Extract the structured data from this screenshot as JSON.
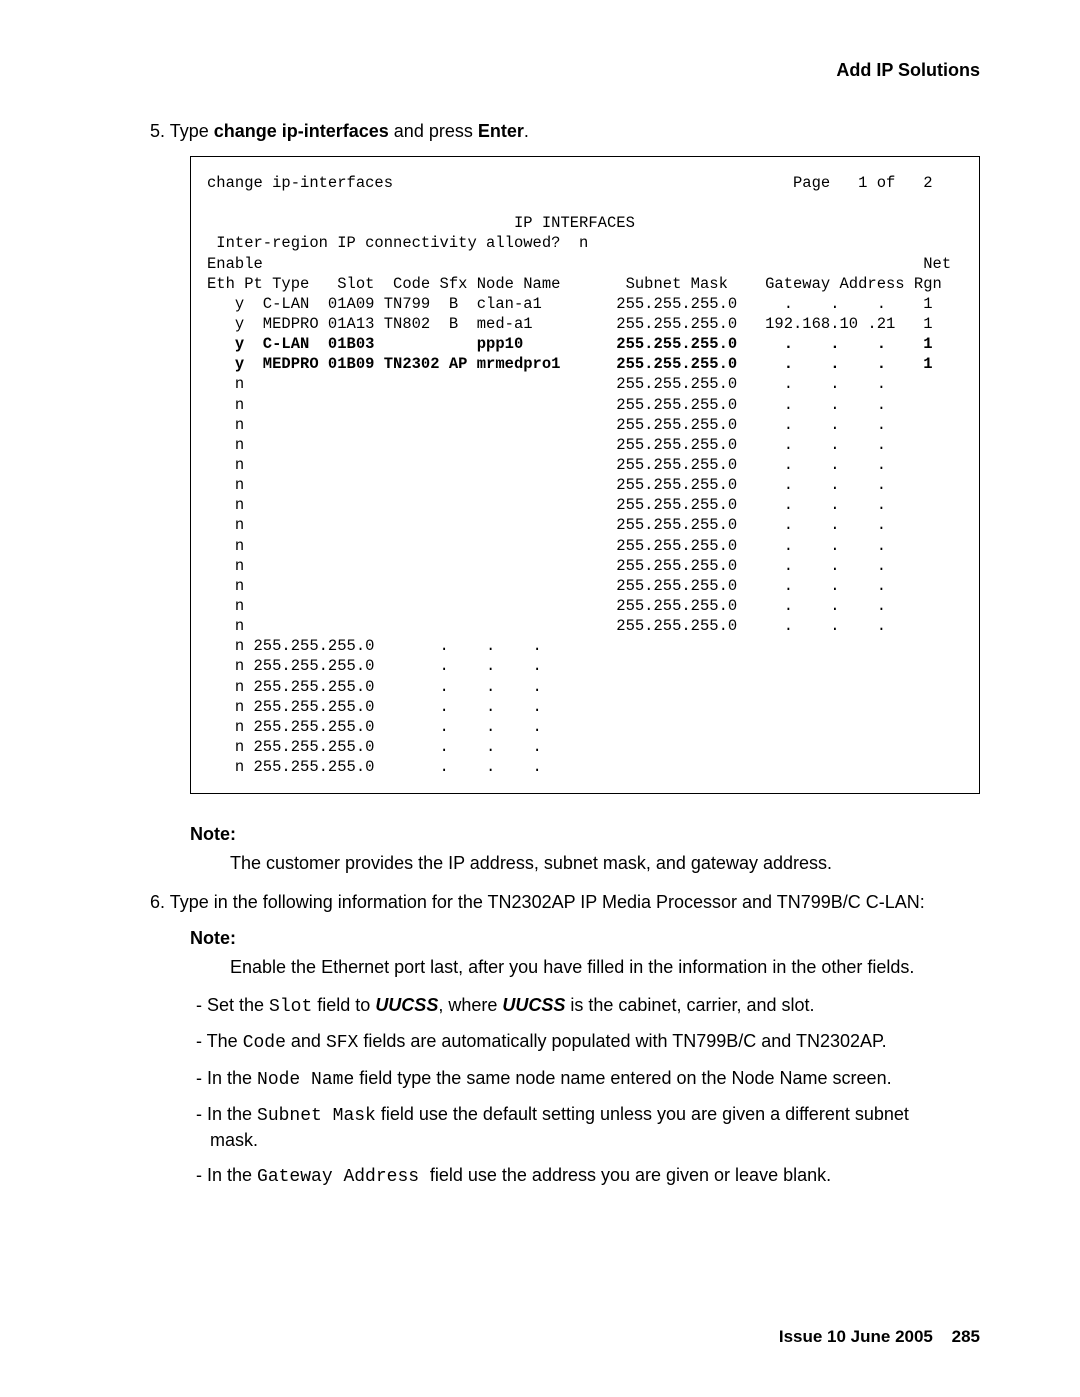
{
  "header": {
    "section": "Add IP Solutions"
  },
  "step5": {
    "num": "5.",
    "pre": "Type ",
    "cmd": "change ip-interfaces",
    "mid": " and press ",
    "key": "Enter",
    "post": "."
  },
  "terminal": {
    "l01": "change ip-interfaces                                           Page   1 of   2",
    "l02": "",
    "l03": "                                 IP INTERFACES",
    "l04": " Inter-region IP connectivity allowed?  n",
    "l05": "Enable                                                                       Net",
    "l06": "Eth Pt Type   Slot  Code Sfx Node Name       Subnet Mask    Gateway Address Rgn",
    "l07": "   y  C-LAN  01A09 TN799  B  clan-a1        255.255.255.0     .    .    .    1",
    "l08": "   y  MEDPRO 01A13 TN802  B  med-a1         255.255.255.0   192.168.10 .21   1",
    "l09": "   y  C-LAN  01B03           ppp10          255.255.255.0     .    .    .    1",
    "l10": "   y  MEDPRO 01B09 TN2302 AP mrmedpro1      255.255.255.0     .    .    .    1",
    "l11": "   n                                        255.255.255.0     .    .    .",
    "l12": "   n                                        255.255.255.0     .    .    .",
    "l13": "   n                                        255.255.255.0     .    .    .",
    "l14": "   n                                        255.255.255.0     .    .    .",
    "l15": "   n                                        255.255.255.0     .    .    .",
    "l16": "   n                                        255.255.255.0     .    .    .",
    "l17": "   n                                        255.255.255.0     .    .    .",
    "l18": "   n                                        255.255.255.0     .    .    .",
    "l19": "   n                                        255.255.255.0     .    .    .",
    "l20": "   n                                        255.255.255.0     .    .    .",
    "l21": "   n                                        255.255.255.0     .    .    .",
    "l22": "   n                                        255.255.255.0     .    .    .",
    "l23": "   n                                        255.255.255.0     .    .    .",
    "l24": "   n 255.255.255.0       .    .    .",
    "l25": "   n 255.255.255.0       .    .    .",
    "l26": "   n 255.255.255.0       .    .    .",
    "l27": "   n 255.255.255.0       .    .    .",
    "l28": "   n 255.255.255.0       .    .    .",
    "l29": "   n 255.255.255.0       .    .    .",
    "l30": "   n 255.255.255.0       .    .    .",
    "l31": ""
  },
  "note1": {
    "label": "Note:",
    "body": "The customer provides the IP address, subnet mask, and gateway address."
  },
  "step6": {
    "num": "6.",
    "text": "Type in the following information for the TN2302AP IP Media Processor and TN799B/C C-LAN:"
  },
  "note2": {
    "label": "Note:",
    "body": "Enable the Ethernet port last, after you have filled in the information in the other fields."
  },
  "bullets": {
    "b1": {
      "pre": "- Set the ",
      "f": "Slot",
      "mid1": " field to ",
      "v": "UUCSS",
      "mid2": ", where ",
      "v2": "UUCSS",
      "post": " is the cabinet, carrier, and slot."
    },
    "b2": {
      "pre": "- The ",
      "f1": "Code",
      "mid": " and ",
      "f2": "SFX",
      "post": " fields are automatically populated with TN799B/C and TN2302AP."
    },
    "b3": {
      "pre": "- In the ",
      "f": "Node Name",
      "post": " field type the same node name entered on the Node Name screen."
    },
    "b4": {
      "pre": "- In the ",
      "f": "Subnet Mask",
      "post": " field use the default setting unless you are given a different subnet mask."
    },
    "b5": {
      "pre": "- In the ",
      "f": "Gateway Address ",
      "post": " field use the address you are given or leave blank."
    }
  },
  "footer": {
    "issue": "Issue 10   June 2005",
    "page": "285"
  }
}
